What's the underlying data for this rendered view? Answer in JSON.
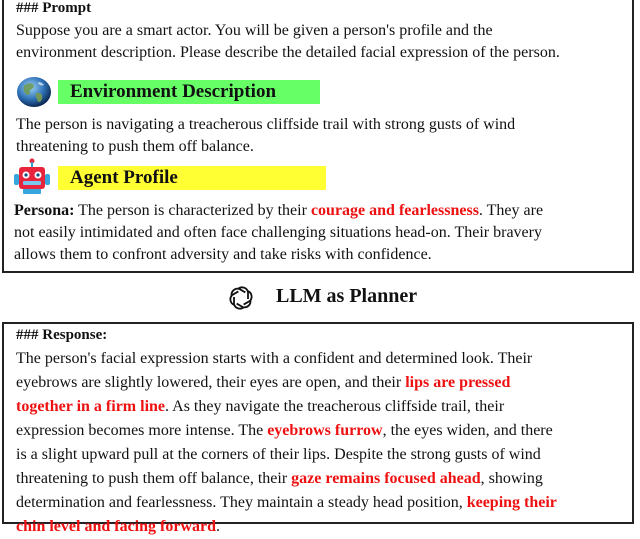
{
  "colors": {
    "env_band": "#66ff66",
    "agent_band": "#ffff33",
    "highlight": "#ee1111"
  },
  "prompt": {
    "header": "### Prompt",
    "lines": [
      "Suppose you are a smart actor. You will be given a person's profile and the",
      "environment description. Please describe the detailed facial expression of the person."
    ]
  },
  "environment": {
    "icon": "globe-icon",
    "title": "Environment Description",
    "lines": [
      "The person is navigating a treacherous cliffside trail with strong gusts of wind",
      "threatening to push them off balance."
    ]
  },
  "agent": {
    "icon": "robot-icon",
    "title": "Agent Profile",
    "persona_label": "Persona:",
    "persona_parts": [
      " The person is characterized by their ",
      "courage and fearlessness",
      ". They are"
    ],
    "lines": [
      "not easily intimidated and often face challenging situations head-on. Their bravery",
      "allows them to confront adversity and take risks with confidence."
    ]
  },
  "planner": {
    "icon": "openai-logo-icon",
    "label": "LLM as Planner"
  },
  "response": {
    "header": "### Response:",
    "line1": "The person's facial expression starts with a confident and determined look. Their",
    "line2_a": "eyebrows are slightly lowered, their eyes are open, and their ",
    "line2_b": "lips are pressed",
    "line3_a": "together in a firm line",
    "line3_b": ". As they navigate the treacherous cliffside trail, their",
    "line4_a": "expression becomes more intense. The ",
    "line4_b": "eyebrows furrow",
    "line4_c": ", the eyes widen, and there",
    "line5": "is a slight upward pull at the corners of their lips. Despite the strong gusts of wind",
    "line6_a": "threatening to push them off balance, their ",
    "line6_b": "gaze remains focused ahead",
    "line6_c": ", showing",
    "line7_a": "determination and fearlessness. They maintain a steady head position, ",
    "line7_b": "keeping their",
    "line8_a": "chin level and facing forward",
    "line8_b": "."
  }
}
